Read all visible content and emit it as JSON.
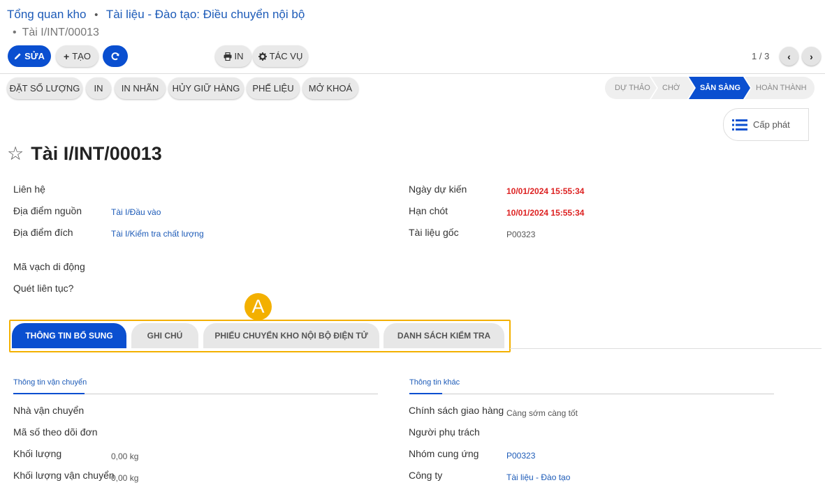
{
  "breadcrumb": {
    "items": [
      "Tổng quan kho",
      "Tài liệu - Đào tạo: Điều chuyển nội bộ"
    ],
    "separator": "•",
    "current": "Tài I/INT/00013",
    "bullet": "•"
  },
  "toolbar": {
    "edit_label": "SỬA",
    "create_label": "TẠO",
    "print_label": "IN",
    "action_label": "TÁC VỤ",
    "pager": "1 / 3"
  },
  "actions": [
    "ĐẶT SỐ LƯỢNG",
    "IN",
    "IN NHÃN",
    "HỦY GIỮ HÀNG",
    "PHẾ LIỆU",
    "MỞ KHOÁ"
  ],
  "status": {
    "stages": [
      "DỰ THẢO",
      "CHỜ",
      "SẴN SÀNG",
      "HOÀN THÀNH"
    ],
    "active": "SẴN SÀNG"
  },
  "smart_button": {
    "label": "Cấp phát"
  },
  "record": {
    "title": "Tài I/INT/00013"
  },
  "fields_left": {
    "contact": {
      "label": "Liên hệ",
      "value": ""
    },
    "source": {
      "label": "Địa điểm nguồn",
      "value": "Tài I/Đầu vào"
    },
    "dest": {
      "label": "Địa điểm đích",
      "value": "Tài I/Kiểm tra chất lượng"
    },
    "barcode": {
      "label": "Mã vạch di động"
    },
    "continuous": {
      "label": "Quét liên tục?"
    }
  },
  "fields_right": {
    "scheduled": {
      "label": "Ngày dự kiến",
      "value": "10/01/2024 15:55:34"
    },
    "deadline": {
      "label": "Hạn chót",
      "value": "10/01/2024 15:55:34"
    },
    "origin": {
      "label": "Tài liệu gốc",
      "value": "P00323"
    }
  },
  "annotation_badge": "A",
  "tabs": [
    "THÔNG TIN BỔ SUNG",
    "GHI CHÚ",
    "PHIẾU CHUYỂN KHO NỘI BỘ ĐIỆN TỬ",
    "DANH SÁCH KIỂM TRA"
  ],
  "shipping": {
    "title": "Thông tin vận chuyển",
    "carrier": "Nhà vận chuyển",
    "tracking": "Mã số theo dõi đơn",
    "weight_label": "Khối lượng",
    "weight_value": "0,00 kg",
    "ship_weight_label": "Khối lượng vận chuyển",
    "ship_weight_value": "0,00 kg"
  },
  "other": {
    "title": "Thông tin khác",
    "policy_label": "Chính sách giao hàng",
    "policy_value": "Càng sớm càng tốt",
    "responsible_label": "Người phụ trách",
    "group_label": "Nhóm cung ứng",
    "group_value": "P00323",
    "company_label": "Công ty",
    "company_value": "Tài liệu - Đào tạo"
  },
  "colors": {
    "primary": "#0a4fd0",
    "link": "#1d5bb8",
    "danger": "#dd2222",
    "highlight": "#f3b000"
  }
}
